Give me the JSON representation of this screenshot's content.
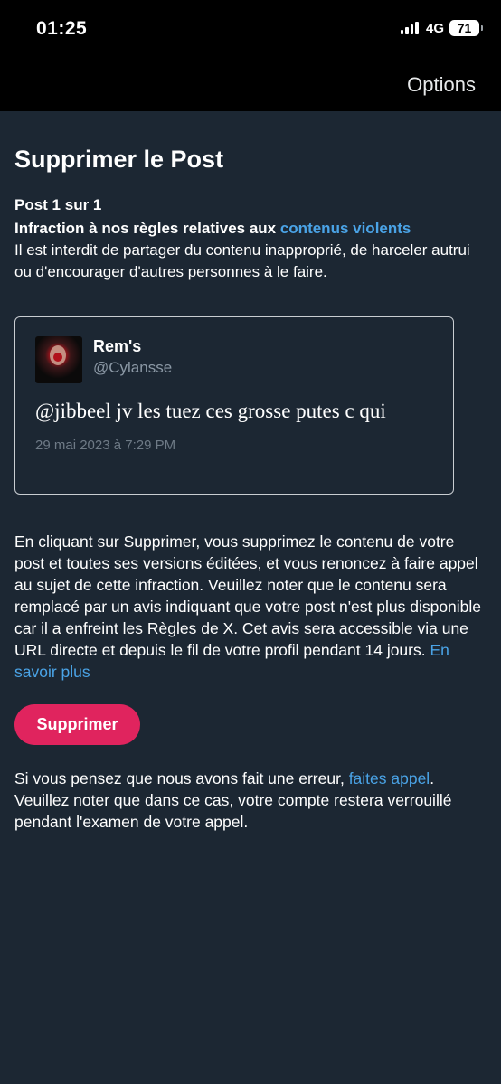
{
  "status_bar": {
    "time": "01:25",
    "network": "4G",
    "battery": "71"
  },
  "header": {
    "options_label": "Options"
  },
  "main": {
    "title": "Supprimer le Post",
    "post_count": "Post 1 sur 1",
    "infraction_prefix": "Infraction à nos règles relatives aux ",
    "infraction_link": "contenus violents",
    "infraction_description": "Il est interdit de partager du contenu inapproprié, de harceler autrui ou d'encourager d'autres personnes à le faire."
  },
  "tweet": {
    "author_name": "Rem's",
    "author_handle": "@Cylansse",
    "text": "@jibbeel jv les tuez ces grosse putes c qui",
    "date": "29 mai 2023 à 7:29 PM"
  },
  "explanation": {
    "text": "En cliquant sur Supprimer, vous supprimez le contenu de votre post et toutes ses versions éditées, et vous renoncez à faire appel au sujet de cette infraction. Veuillez noter que le contenu sera remplacé par un avis indiquant que votre post n'est plus disponible car il a enfreint les Règles de X. Cet avis sera accessible via une URL directe et depuis le fil de votre profil pendant 14 jours. ",
    "learn_more_link": "En savoir plus"
  },
  "delete_button": {
    "label": "Supprimer"
  },
  "appeal": {
    "prefix": "Si vous pensez que nous avons fait une erreur, ",
    "link": "faites appel",
    "suffix": ". Veuillez noter que dans ce cas, votre compte restera verrouillé pendant l'examen de votre appel."
  },
  "colors": {
    "background": "#1c2733",
    "link": "#4aa3e6",
    "danger_button": "#e0245e"
  }
}
